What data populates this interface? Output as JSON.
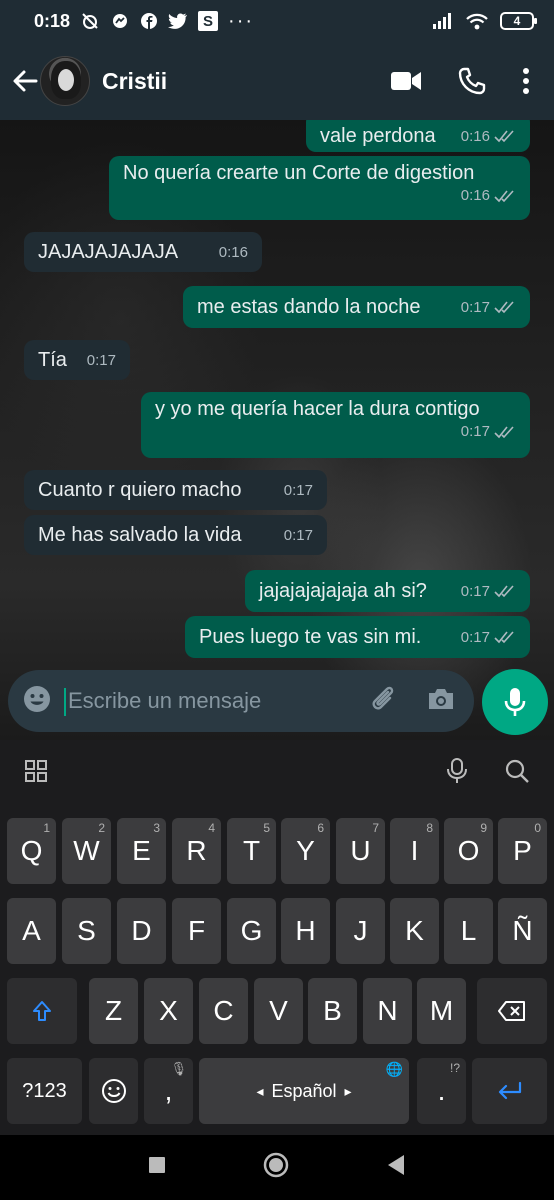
{
  "status_bar": {
    "time": "0:18",
    "battery": "4"
  },
  "header": {
    "contact_name": "Cristii"
  },
  "messages": [
    {
      "text": "vale perdona",
      "time": "0:16"
    },
    {
      "text": "No quería crearte un Corte de digestion",
      "time": "0:16"
    },
    {
      "text": "JAJAJAJAJAJA",
      "time": "0:16"
    },
    {
      "text": "me estas dando la noche",
      "time": "0:17"
    },
    {
      "text": "Tía",
      "time": "0:17"
    },
    {
      "text": "y yo me quería hacer la dura contigo",
      "time": "0:17"
    },
    {
      "text": "Cuanto r quiero macho",
      "time": "0:17"
    },
    {
      "text": "Me has salvado la vida",
      "time": "0:17"
    },
    {
      "text": "jajajajajajaja ah si?",
      "time": "0:17"
    },
    {
      "text": "Pues luego te vas sin mi.",
      "time": "0:17"
    }
  ],
  "input": {
    "placeholder": "Escribe un mensaje"
  },
  "keyboard": {
    "row1": [
      {
        "key": "Q",
        "num": "1"
      },
      {
        "key": "W",
        "num": "2"
      },
      {
        "key": "E",
        "num": "3"
      },
      {
        "key": "R",
        "num": "4"
      },
      {
        "key": "T",
        "num": "5"
      },
      {
        "key": "Y",
        "num": "6"
      },
      {
        "key": "U",
        "num": "7"
      },
      {
        "key": "I",
        "num": "8"
      },
      {
        "key": "O",
        "num": "9"
      },
      {
        "key": "P",
        "num": "0"
      }
    ],
    "row2": [
      "A",
      "S",
      "D",
      "F",
      "G",
      "H",
      "J",
      "K",
      "L",
      "Ñ"
    ],
    "row3": [
      "Z",
      "X",
      "C",
      "V",
      "B",
      "N",
      "M"
    ],
    "symbols_key": "?123",
    "comma": ",",
    "space_label": "Español",
    "period": ".",
    "period_hint": "!?"
  },
  "colors": {
    "outgoing": "#005c4b",
    "incoming": "#202c33",
    "accent": "#00a884"
  }
}
